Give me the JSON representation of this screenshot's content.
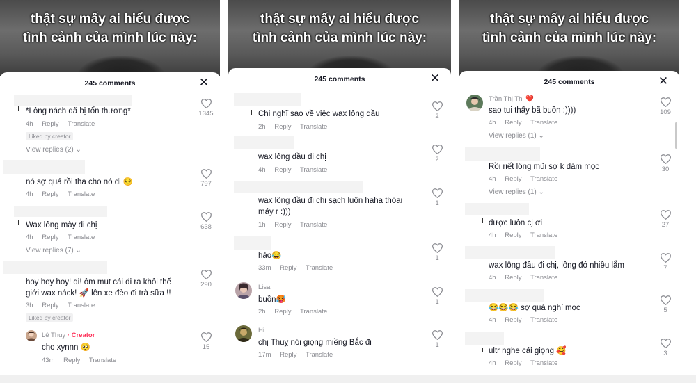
{
  "caption_lines": [
    "thật sự mấy ai hiểu được",
    "tình cảnh của mình lúc này:"
  ],
  "sheet_title": "245 comments",
  "close_symbol": "✕",
  "accent": "#fe2c55",
  "panels": [
    {
      "comments": [
        {
          "text": "*Lông nách đã bị tổn thương*",
          "time": "4h",
          "reply": "Reply",
          "translate": "Translate",
          "likes": "1345",
          "liked_by_creator": "Liked by creator",
          "view_replies": "View replies (2)"
        },
        {
          "text": "nó sợ quá rồi tha cho nó đi 😔",
          "time": "4h",
          "reply": "Reply",
          "translate": "Translate",
          "likes": "797"
        },
        {
          "text": "Wax lông mày đi chị",
          "time": "4h",
          "reply": "Reply",
          "translate": "Translate",
          "likes": "638",
          "view_replies": "View replies (7)"
        },
        {
          "text_lines": [
            "hoy hoy hoy! đi! ôm mụt cái đi ra khỏi thế",
            "giới wax náck! 🚀 lên xe đèo đi trà sữa !!"
          ],
          "time": "3h",
          "reply": "Reply",
          "translate": "Translate",
          "likes": "290",
          "liked_by_creator": "Liked by creator"
        },
        {
          "user": "Lê Thuy",
          "creator_tag": "· Creator",
          "text": "cho xynnn 🥺",
          "time": "43m",
          "reply": "Reply",
          "translate": "Translate",
          "likes": "15"
        }
      ]
    },
    {
      "comments": [
        {
          "text": "Chị nghĩ sao về việc wax lông đầu",
          "time": "2h",
          "reply": "Reply",
          "translate": "Translate",
          "likes": "2"
        },
        {
          "text": "wax lông đầu đi chị",
          "time": "4h",
          "reply": "Reply",
          "translate": "Translate",
          "likes": "2"
        },
        {
          "text_lines": [
            "wax lông đầu đi chị sạch luôn haha thôai",
            "máy r :)))"
          ],
          "time": "1h",
          "reply": "Reply",
          "translate": "Translate",
          "likes": "1"
        },
        {
          "text": "hảo😂",
          "time": "33m",
          "reply": "Reply",
          "translate": "Translate",
          "likes": "1"
        },
        {
          "user": "Lisa",
          "text": "buồn🥵",
          "time": "2h",
          "reply": "Reply",
          "translate": "Translate",
          "likes": "1"
        },
        {
          "user": "Hi",
          "text": "chị Thuỵ nói giọng miềng Bắc đi",
          "time": "17m",
          "reply": "Reply",
          "translate": "Translate",
          "likes": "1"
        }
      ]
    },
    {
      "comments": [
        {
          "user": "Trần Thị Thi ❤️",
          "text": "sao tui thấy bã buồn :))))",
          "time": "4h",
          "reply": "Reply",
          "translate": "Translate",
          "likes": "109",
          "view_replies": "View replies (1)"
        },
        {
          "text": "Rồi riết lông mũi sợ k dám mọc",
          "time": "4h",
          "reply": "Reply",
          "translate": "Translate",
          "likes": "30",
          "view_replies": "View replies (1)"
        },
        {
          "text": "được luôn cj ơi",
          "time": "4h",
          "reply": "Reply",
          "translate": "Translate",
          "likes": "27"
        },
        {
          "text": "wax lông đầu đi chị, lông đó nhiều lắm",
          "time": "4h",
          "reply": "Reply",
          "translate": "Translate",
          "likes": "7"
        },
        {
          "text": "😂😂😂 sợ quá nghỉ mọc",
          "time": "4h",
          "reply": "Reply",
          "translate": "Translate",
          "likes": "5"
        },
        {
          "text": "ultr nghe cái giọng 🥰",
          "time": "4h",
          "reply": "Reply",
          "translate": "Translate",
          "likes": "3"
        }
      ]
    }
  ]
}
